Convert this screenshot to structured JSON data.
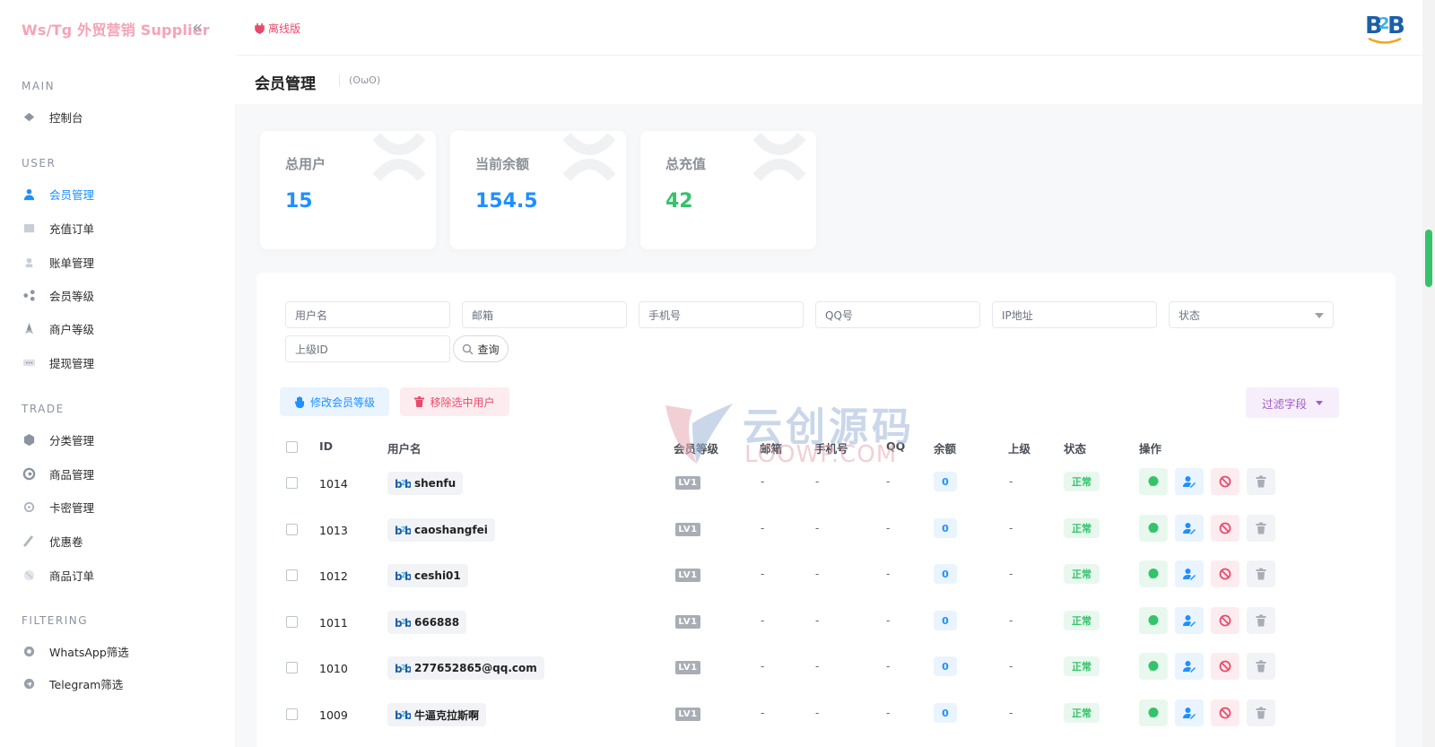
{
  "sidebar": {
    "brand": "Ws/Tg 外贸营销 Supplier",
    "collapse_icon": "«",
    "sections": {
      "main": "MAIN",
      "user": "USER",
      "trade": "TRADE",
      "filtering": "FILTERING"
    },
    "items": [
      {
        "label": "控制台",
        "icon": "dashboard-icon"
      },
      {
        "label": "会员管理",
        "icon": "user-icon",
        "active": true
      },
      {
        "label": "充值订单",
        "icon": "recharge-icon"
      },
      {
        "label": "账单管理",
        "icon": "bill-icon"
      },
      {
        "label": "会员等级",
        "icon": "share-icon"
      },
      {
        "label": "商户等级",
        "icon": "rocket-icon"
      },
      {
        "label": "提现管理",
        "icon": "withdraw-icon"
      },
      {
        "label": "分类管理",
        "icon": "category-icon"
      },
      {
        "label": "商品管理",
        "icon": "goods-icon"
      },
      {
        "label": "卡密管理",
        "icon": "card-icon"
      },
      {
        "label": "优惠卷",
        "icon": "coupon-icon"
      },
      {
        "label": "商品订单",
        "icon": "order-icon"
      },
      {
        "label": "WhatsApp筛选",
        "icon": "whatsapp-icon"
      },
      {
        "label": "Telegram筛选",
        "icon": "telegram-icon"
      }
    ]
  },
  "topbar": {
    "offline_label": "离线版",
    "logo": "B2B"
  },
  "page": {
    "title": "会员管理",
    "subtitle": "(ʘωʘ)"
  },
  "stats": [
    {
      "label": "总用户",
      "value": "15",
      "color": "#1e90ff"
    },
    {
      "label": "当前余额",
      "value": "154.5",
      "color": "#1e90ff"
    },
    {
      "label": "总充值",
      "value": "42",
      "color": "#34c36b"
    }
  ],
  "filters": {
    "username": "用户名",
    "email": "邮箱",
    "phone": "手机号",
    "qq": "QQ号",
    "ip": "IP地址",
    "status": "状态",
    "parent_id": "上级ID",
    "query_label": "查询"
  },
  "actions": {
    "change_level": "修改会员等级",
    "remove_selected": "移除选中用户",
    "filter_fields": "过滤字段"
  },
  "table": {
    "headers": {
      "id": "ID",
      "username": "用户名",
      "level": "会员等级",
      "email": "邮箱",
      "phone": "手机号",
      "qq": "QQ",
      "balance": "余额",
      "parent": "上级",
      "status": "状态",
      "ops": "操作"
    },
    "rows": [
      {
        "id": "1014",
        "username": "shenfu",
        "level": "LV1",
        "email": "-",
        "phone": "-",
        "qq": "-",
        "balance": "0",
        "parent": "-",
        "status": "正常"
      },
      {
        "id": "1013",
        "username": "caoshangfei",
        "level": "LV1",
        "email": "-",
        "phone": "-",
        "qq": "-",
        "balance": "0",
        "parent": "-",
        "status": "正常"
      },
      {
        "id": "1012",
        "username": "ceshi01",
        "level": "LV1",
        "email": "-",
        "phone": "-",
        "qq": "-",
        "balance": "0",
        "parent": "-",
        "status": "正常"
      },
      {
        "id": "1011",
        "username": "666888",
        "level": "LV1",
        "email": "-",
        "phone": "-",
        "qq": "-",
        "balance": "0",
        "parent": "-",
        "status": "正常"
      },
      {
        "id": "1010",
        "username": "277652865@qq.com",
        "level": "LV1",
        "email": "-",
        "phone": "-",
        "qq": "-",
        "balance": "0",
        "parent": "-",
        "status": "正常"
      },
      {
        "id": "1009",
        "username": "牛逼克拉斯啊",
        "level": "LV1",
        "email": "-",
        "phone": "-",
        "qq": "-",
        "balance": "0",
        "parent": "-",
        "status": "正常"
      }
    ]
  },
  "watermark": {
    "title": "云创源码",
    "subtitle": "LOOWP.COM"
  }
}
